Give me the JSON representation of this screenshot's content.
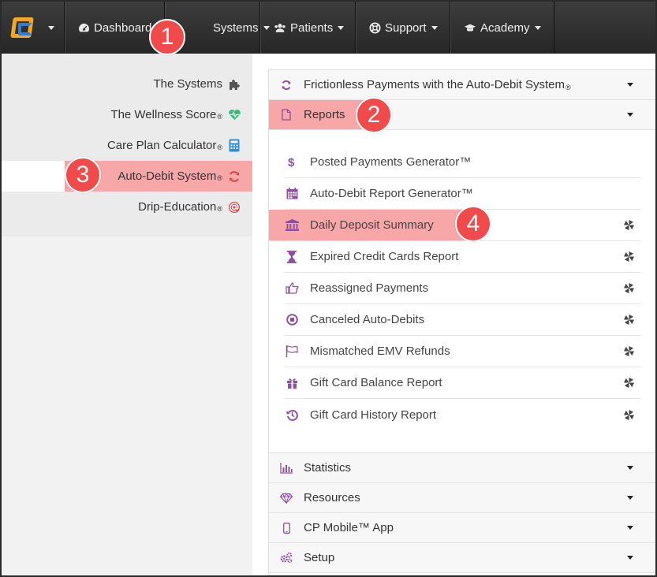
{
  "navbar": {
    "logo": "logo-icon",
    "items": [
      {
        "label": "Dashboard",
        "icon": "dashboard-icon"
      },
      {
        "label": "Systems",
        "icon": "systems-icon"
      },
      {
        "label": "Patients",
        "icon": "users-icon"
      },
      {
        "label": "Support",
        "icon": "lifebuoy-icon"
      },
      {
        "label": "Academy",
        "icon": "graduation-cap-icon"
      }
    ]
  },
  "sidebar": {
    "items": [
      {
        "label": "The Systems",
        "reg": "",
        "icon": "puzzle-icon",
        "color": "#555555"
      },
      {
        "label": "The Wellness Score",
        "reg": "®",
        "icon": "heartbeat-icon",
        "color": "#3cb878"
      },
      {
        "label": "Care Plan Calculator",
        "reg": "®",
        "icon": "calculator-icon",
        "color": "#2f8fd6"
      },
      {
        "label": "Auto-Debit System",
        "reg": "®",
        "icon": "refresh-icon",
        "color": "#d84a4a"
      },
      {
        "label": "Drip-Education",
        "reg": "®",
        "icon": "at-icon",
        "color": "#e84040"
      }
    ]
  },
  "main": {
    "sections": [
      {
        "label": "Frictionless Payments with the Auto-Debit System",
        "reg": "®",
        "icon": "refresh-icon"
      },
      {
        "label": "Reports",
        "reg": "",
        "icon": "file-icon"
      }
    ],
    "reports": [
      {
        "label": "Posted Payments Generator™",
        "icon": "dollar-icon",
        "pin": false
      },
      {
        "label": "Auto-Debit Report Generator™",
        "icon": "calendar-icon",
        "pin": false
      },
      {
        "label": "Daily Deposit Summary",
        "icon": "bank-icon",
        "pin": true
      },
      {
        "label": "Expired Credit Cards Report",
        "icon": "hourglass-icon",
        "pin": true
      },
      {
        "label": "Reassigned Payments",
        "icon": "hand-point-icon",
        "pin": true
      },
      {
        "label": "Canceled Auto-Debits",
        "icon": "stop-circle-icon",
        "pin": true
      },
      {
        "label": "Mismatched EMV Refunds",
        "icon": "flag-icon",
        "pin": true
      },
      {
        "label": "Gift Card Balance Report",
        "icon": "gift-icon",
        "pin": true
      },
      {
        "label": "Gift Card History Report",
        "icon": "history-icon",
        "pin": true
      }
    ],
    "lower_sections": [
      {
        "label": "Statistics",
        "icon": "bar-chart-icon"
      },
      {
        "label": "Resources",
        "icon": "diamond-icon"
      },
      {
        "label": "CP Mobile™ App",
        "icon": "mobile-icon"
      },
      {
        "label": "Setup",
        "icon": "cogs-icon"
      }
    ]
  },
  "callouts": [
    "1",
    "2",
    "3",
    "4"
  ],
  "colors": {
    "accent_purple": "#8e4fa0",
    "highlight": "#f7a7a7",
    "badge": "#f04a4a",
    "navbar": "#2f2f2f"
  }
}
